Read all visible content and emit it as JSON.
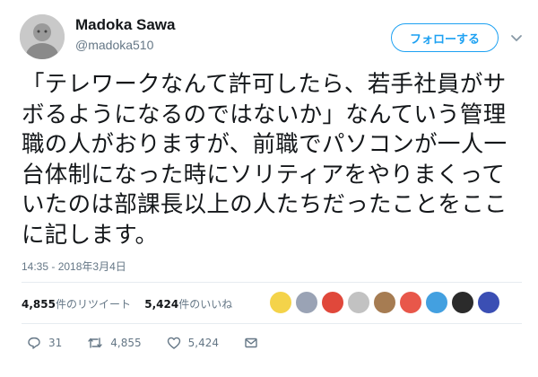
{
  "user": {
    "name": "Madoka Sawa",
    "handle": "@madoka510",
    "avatar_icon": "profile-avatar"
  },
  "follow_button": {
    "label": "フォローする",
    "color": "#1da1f2"
  },
  "tweet": {
    "text": "「テレワークなんて許可したら、若手社員がサボるようになるのではないか」なんていう管理職の人がおりますが、前職でパソコンが一人一台体制になった時にソリティアをやりまくっていたのは部課長以上の人たちだったことをここに記します。",
    "timestamp": "14:35 - 2018年3月4日"
  },
  "stats": {
    "retweets_count": "4,855",
    "retweets_label": "件のリツイート",
    "likes_count": "5,424",
    "likes_label": "件のいいね",
    "liker_colors": [
      "#f4d34a",
      "#9aa3b5",
      "#e0483b",
      "#c2c2c2",
      "#a67c52",
      "#e8574a",
      "#43a0e0",
      "#2b2b2b",
      "#3b4fb4"
    ]
  },
  "actions": {
    "reply_count": "31",
    "retweet_count": "4,855",
    "like_count": "5,424"
  }
}
